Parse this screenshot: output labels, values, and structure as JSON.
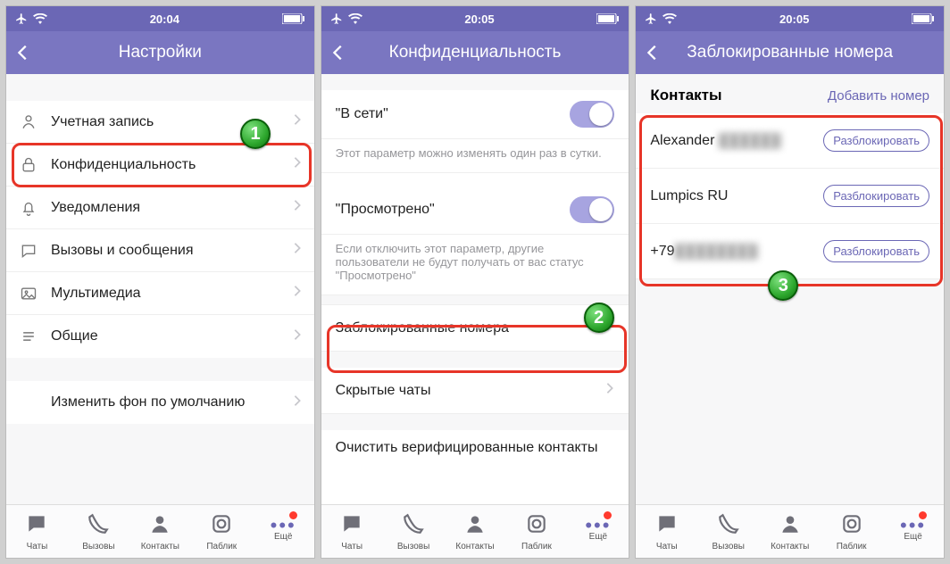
{
  "screens": [
    {
      "status": {
        "time": "20:04"
      },
      "title": "Настройки",
      "rows": [
        {
          "icon": "user-icon",
          "label": "Учетная запись"
        },
        {
          "icon": "lock-icon",
          "label": "Конфиденциальность"
        },
        {
          "icon": "bell-icon",
          "label": "Уведомления"
        },
        {
          "icon": "chat-icon",
          "label": "Вызовы и сообщения"
        },
        {
          "icon": "media-icon",
          "label": "Мультимедиа"
        },
        {
          "icon": "list-icon",
          "label": "Общие"
        }
      ],
      "bg_row": {
        "label": "Изменить фон по умолчанию"
      }
    },
    {
      "status": {
        "time": "20:05"
      },
      "title": "Конфиденциальность",
      "opt1": {
        "title": "\"В сети\"",
        "desc": "Этот параметр можно изменять один раз в сутки."
      },
      "opt2": {
        "title": "\"Просмотрено\"",
        "desc": "Если отключить этот параметр, другие пользователи не будут получать от вас статус \"Просмотрено\""
      },
      "nav1": {
        "label": "Заблокированные номера"
      },
      "nav2": {
        "label": "Скрытые чаты"
      },
      "nav3": {
        "label": "Очистить верифицированные контакты"
      }
    },
    {
      "status": {
        "time": "20:05"
      },
      "title": "Заблокированные номера",
      "header": "Контакты",
      "add": "Добавить номер",
      "contacts": [
        {
          "name": "Alexander",
          "blurred": "▓▓▓▓▓▓",
          "btn": "Разблокировать"
        },
        {
          "name": "Lumpics RU",
          "blurred": "",
          "btn": "Разблокировать"
        },
        {
          "name": "+79",
          "blurred": "▓▓▓▓▓▓▓▓",
          "btn": "Разблокировать"
        }
      ]
    }
  ],
  "tabs": [
    {
      "label": "Чаты",
      "icon": "chat"
    },
    {
      "label": "Вызовы",
      "icon": "call"
    },
    {
      "label": "Контакты",
      "icon": "person"
    },
    {
      "label": "Паблик",
      "icon": "public"
    },
    {
      "label": "Ещё",
      "icon": "more"
    }
  ],
  "callouts": {
    "c1": "1",
    "c2": "2",
    "c3": "3"
  }
}
